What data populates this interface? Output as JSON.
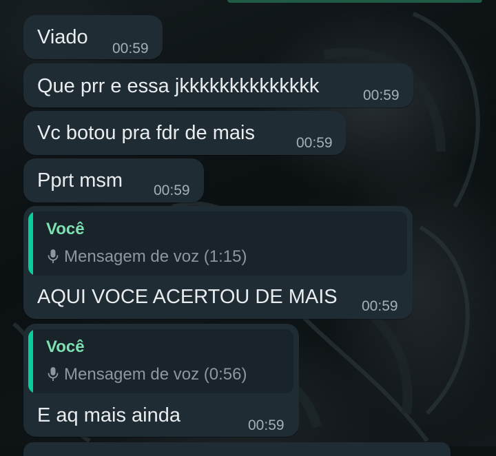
{
  "messages": [
    {
      "text": "Viado",
      "time": "00:59"
    },
    {
      "text": "Que prr e essa jkkkkkkkkkkkkkk",
      "time": "00:59"
    },
    {
      "text": "Vc botou pra fdr de mais",
      "time": "00:59"
    },
    {
      "text": "Pprt msm",
      "time": "00:59"
    },
    {
      "text": "AQUI VOCE ACERTOU DE MAIS",
      "time": "00:59",
      "quote": {
        "sender": "Você",
        "body": "Mensagem de voz (1:15)",
        "icon": "mic-icon"
      }
    },
    {
      "text": "E aq mais ainda",
      "time": "00:59",
      "quote": {
        "sender": "Você",
        "body": "Mensagem de voz (0:56)",
        "icon": "mic-icon"
      }
    }
  ],
  "colors": {
    "bubble": "#1f2c33",
    "quote_bg": "#18232a",
    "quote_bar": "#06cf9c",
    "quote_sender": "#7ee0b0",
    "text": "#e9edef",
    "time": "#a5b0b6"
  }
}
